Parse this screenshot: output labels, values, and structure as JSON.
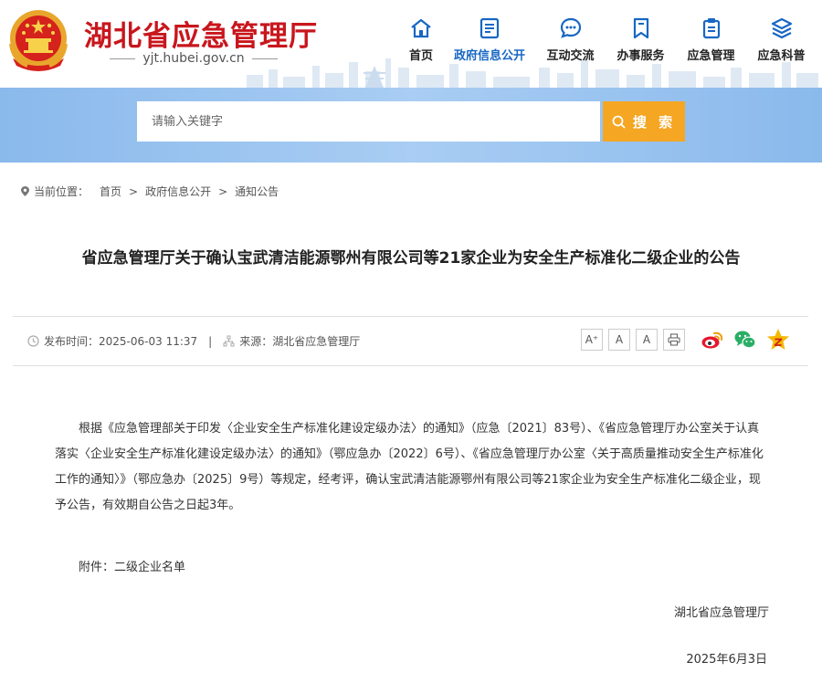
{
  "header": {
    "site_title": "湖北省应急管理厅",
    "site_domain": "yjt.hubei.gov.cn",
    "nav": [
      {
        "label": "首页",
        "icon": "home-icon"
      },
      {
        "label": "政府信息公开",
        "icon": "document-icon",
        "active": true
      },
      {
        "label": "互动交流",
        "icon": "chat-bubble-icon"
      },
      {
        "label": "办事服务",
        "icon": "bookmark-icon"
      },
      {
        "label": "应急管理",
        "icon": "clipboard-icon"
      },
      {
        "label": "应急科普",
        "icon": "layers-icon"
      }
    ]
  },
  "search": {
    "placeholder": "请输入关键字",
    "button_label": "搜 索"
  },
  "breadcrumb": {
    "prefix": "当前位置：",
    "items": [
      "首页",
      "政府信息公开",
      "通知公告"
    ],
    "separator": ">"
  },
  "article": {
    "title": "省应急管理厅关于确认宝武清洁能源鄂州有限公司等21家企业为安全生产标准化二级企业的公告",
    "publish_label": "发布时间：",
    "publish_time": "2025-06-03 11:37",
    "meta_divider": "|",
    "source_label": "来源：",
    "source": "湖北省应急管理厅",
    "font_tools": [
      "A⁺",
      "A",
      "A"
    ],
    "body": "根据《应急管理部关于印发〈企业安全生产标准化建设定级办法〉的通知》（应急〔2021〕83号）、《省应急管理厅办公室关于认真落实〈企业安全生产标准化建设定级办法〉的通知》（鄂应急办〔2022〕6号）、《省应急管理厅办公室〈关于高质量推动安全生产标准化工作的通知〉》（鄂应急办〔2025〕9号）等规定，经考评，确认宝武清洁能源鄂州有限公司等21家企业为安全生产标准化二级企业，现予公告，有效期自公告之日起3年。",
    "attachment_label": "附件：",
    "attachment_name": "二级企业名单",
    "signer": "湖北省应急管理厅",
    "date": "2025年6月3日"
  },
  "colors": {
    "brand_red": "#c8161d",
    "nav_active": "#1767c3",
    "search_button": "#f5a623",
    "search_band": "#9cc5f0"
  }
}
